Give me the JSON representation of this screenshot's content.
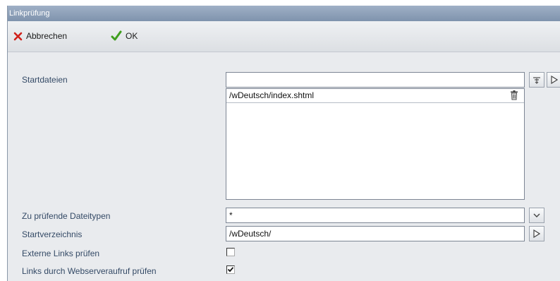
{
  "window": {
    "title": "Linkprüfung"
  },
  "toolbar": {
    "cancel_label": "Abbrechen",
    "ok_label": "OK"
  },
  "form": {
    "startdateien": {
      "label": "Startdateien",
      "input_value": "",
      "files": [
        "/wDeutsch/index.shtml"
      ]
    },
    "dateitypen": {
      "label": "Zu prüfende Dateitypen",
      "value": "*"
    },
    "startverzeichnis": {
      "label": "Startverzeichnis",
      "value": "/wDeutsch/"
    },
    "externe_links": {
      "label": "Externe Links prüfen",
      "checked": false
    },
    "webserveraufruf": {
      "label": "Links durch Webserveraufruf prüfen",
      "checked": true
    }
  },
  "icons": {
    "cancel": "cross-icon",
    "ok": "checkmark-icon",
    "add": "add-to-list-icon",
    "browse": "play-arrow-icon",
    "delete": "trash-icon",
    "dropdown": "chevron-down-icon",
    "folder_browse": "play-arrow-icon"
  },
  "colors": {
    "titlebar": "#8ea1bb",
    "cancel_icon": "#d0201a",
    "ok_icon": "#3f9e1e",
    "label_text": "#344a66"
  }
}
